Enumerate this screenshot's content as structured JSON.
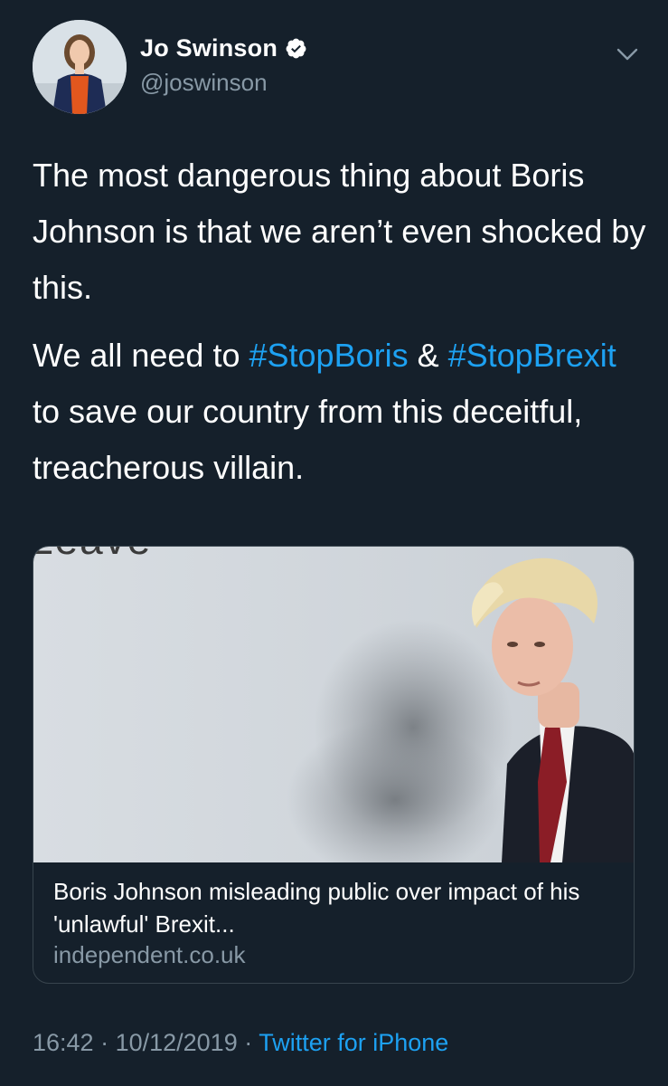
{
  "author": {
    "display_name": "Jo Swinson",
    "handle": "@joswinson",
    "verified": true
  },
  "tweet": {
    "p1": "The most dangerous thing about Boris Johnson is that we aren’t even shocked by this.",
    "p2_pre": "We all need to ",
    "hashtag1": "#StopBoris",
    "p2_mid": " & ",
    "hashtag2": "#StopBrexit",
    "p2_post": " to save our country from this deceitful, treacherous villain."
  },
  "card": {
    "title": "Boris Johnson misleading public over impact of his 'unlawful' Brexit...",
    "domain": "independent.co.uk",
    "image_text": "Leave"
  },
  "meta": {
    "time": "16:42",
    "sep1": " · ",
    "date": "10/12/2019",
    "sep2": " · ",
    "source": "Twitter for iPhone"
  },
  "icons": {
    "verified": "verified-badge-icon",
    "more": "chevron-down-icon"
  },
  "colors": {
    "background": "#15202b",
    "link": "#1da1f2",
    "secondary_text": "#8899a6",
    "border": "#38444d"
  }
}
